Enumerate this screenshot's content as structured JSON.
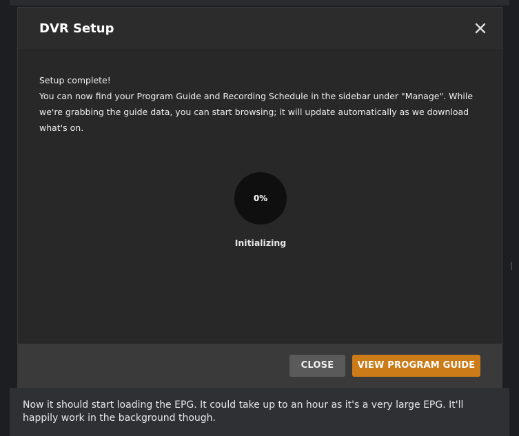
{
  "dialog": {
    "title": "DVR Setup",
    "close_icon": "close-x-icon",
    "body": {
      "line1": "Setup complete!",
      "line2": "You can now find your Program Guide and Recording Schedule in the sidebar under \"Manage\". While we're grabbing the guide data, you can start browsing; it will update automatically as we download what's on."
    },
    "progress": {
      "value": "0%",
      "fraction": 0,
      "status": "Initializing"
    },
    "footer": {
      "close_label": "CLOSE",
      "guide_label": "VIEW PROGRAM GUIDE"
    }
  },
  "caption": {
    "text": "Now it should start loading the EPG. It could take up to an hour as it's a very large EPG. It'll happily work in the background though."
  },
  "colors": {
    "accent": "#cc7b19",
    "dialog_bg": "#282828",
    "footer_bg": "#3a3a3a"
  }
}
